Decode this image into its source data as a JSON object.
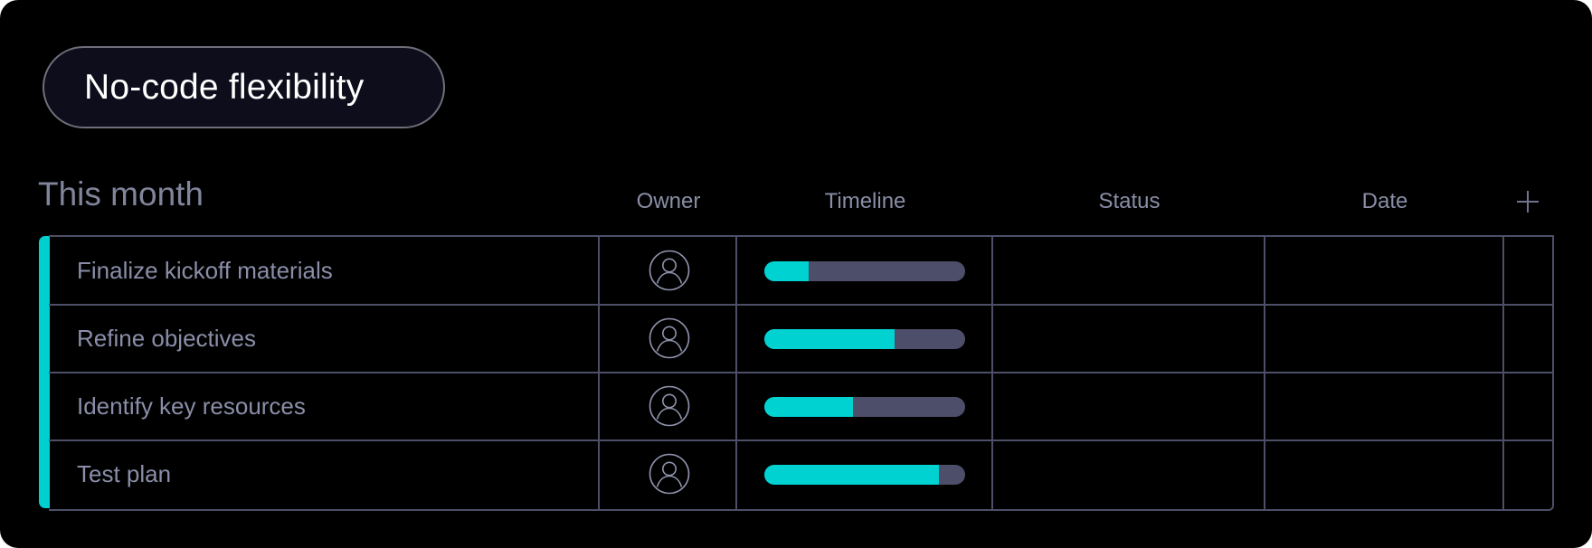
{
  "badge": {
    "label": "No-code flexibility"
  },
  "group": {
    "title": "This month",
    "accent_color": "#00cfd0"
  },
  "columns": {
    "owner": "Owner",
    "timeline": "Timeline",
    "status": "Status",
    "date": "Date",
    "add_column_icon": "plus-icon"
  },
  "rows": [
    {
      "name": "Finalize kickoff materials",
      "owner_icon": "user-avatar-icon",
      "timeline_progress": 0.22,
      "status": "",
      "date": ""
    },
    {
      "name": "Refine objectives",
      "owner_icon": "user-avatar-icon",
      "timeline_progress": 0.65,
      "status": "",
      "date": ""
    },
    {
      "name": "Identify key resources",
      "owner_icon": "user-avatar-icon",
      "timeline_progress": 0.44,
      "status": "",
      "date": ""
    },
    {
      "name": "Test plan",
      "owner_icon": "user-avatar-icon",
      "timeline_progress": 0.87,
      "status": "",
      "date": ""
    }
  ],
  "colors": {
    "timeline_fill": "#00d1d1",
    "timeline_track": "#4c4e6a",
    "grid_line": "#4d4f68",
    "text_muted": "#8a8ea8"
  }
}
